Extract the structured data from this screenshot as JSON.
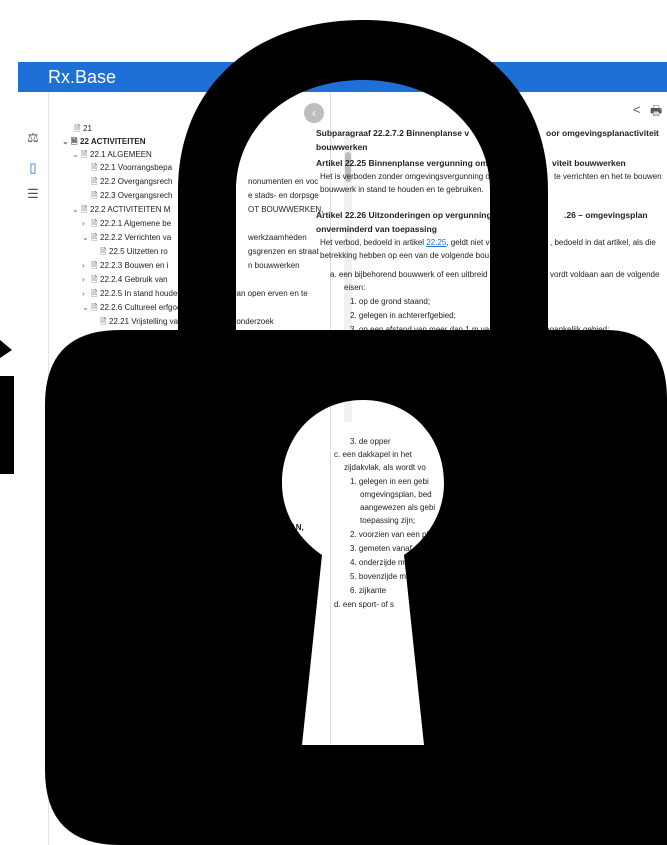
{
  "app": {
    "title": "Rx.Base"
  },
  "rail": {
    "icons": [
      "gavel-icon",
      "book-icon",
      "list-icon"
    ]
  },
  "tree": {
    "nodes": [
      {
        "label": "21",
        "icon": "doc",
        "toggle": ""
      },
      {
        "label": "22 ACTIVITEITEN",
        "icon": "doc",
        "toggle": "v",
        "bold": true
      },
      {
        "label": "22.1 ALGEMEEN",
        "icon": "doc",
        "toggle": "v"
      },
      {
        "label": "22.1 Voorrangsbepa",
        "icon": "doc",
        "toggle": ""
      },
      {
        "label": "22.2 Overgangsrech",
        "icon": "doc",
        "toggle": ""
      },
      {
        "label": "22.3 Overgangsrech",
        "icon": "doc",
        "toggle": ""
      },
      {
        "label": "22.2 ACTIVITEITEN M",
        "icon": "doc",
        "toggle": "v"
      },
      {
        "label": "22.2.1 Algemene be",
        "icon": "doc",
        "toggle": ">"
      },
      {
        "label": "22.2.2 Verrichten va",
        "icon": "doc",
        "toggle": "v"
      },
      {
        "label": "22.5 Uitzetten ro",
        "icon": "doc",
        "toggle": ""
      },
      {
        "label": "22.2.3 Bouwen en i",
        "icon": "doc",
        "toggle": ">"
      },
      {
        "label": "22.2.4 Gebruik van",
        "icon": "doc",
        "toggle": ">"
      },
      {
        "label": "22.2.5 In stand houden en gebruiken van open erven en te",
        "icon": "doc",
        "toggle": ">"
      },
      {
        "label": "22.2.6 Cultureel erfgoed",
        "icon": "doc",
        "toggle": "v"
      },
      {
        "label": "22.21 Vrijstelling van archeologisch onderzoek",
        "icon": "doc",
        "toggle": ""
      }
    ],
    "fragments": {
      "f1": "nonumenten en voc",
      "f2": "e stads- en dorpsge",
      "f3": "OT BOUWWERKEN,",
      "f4": "werkzaamheden",
      "f5": "gsgrenzen en straat",
      "f6": "n bouwwerken",
      "f7": "AN,"
    }
  },
  "content": {
    "subparagraph": "Subparagraaf 22.2.7.2 Binnenplanse v",
    "subparagraph_end": "oor omgevingsplanactiviteit",
    "subparagraph_line2": "bouwwerken",
    "art1_title": "Artikel 22.25 Binnenplanse vergunning om",
    "art1_title_end": "viteit bouwwerken",
    "art1_text1": "Het is verboden zonder omgevingsvergunning o",
    "art1_text1_end": "te verrichten en het te bouwen",
    "art1_text2": "bouwwerk in stand te houden en te gebruiken.",
    "art2_title": "Artikel 22.26 Uitzonderingen op vergunning",
    "art2_title_end": ".26 – omgevingsplan",
    "art2_title2": "onverminderd van toepassing",
    "art2_text1": "Het verbod, bedoeld in artikel",
    "art2_link": "22.25",
    "art2_text1b": ", geldt niet v",
    "art2_text1_end": ", bedoeld in dat artikel, als die",
    "art2_text2": "betrekking hebben op een van de volgende bou",
    "item_a": "a. een bijbehorend bouwwerk of een uitbreid",
    "item_a_end": "vordt voldaan aan de volgende",
    "item_a_2": "eisen:",
    "a1": "1. op de grond staand;",
    "a2": "2. gelegen in achtererfgebied;",
    "a3": "3. op een afstand van meer dan 1 m vanaf openbaar toegankelijk gebied;",
    "b3": "3. de opper",
    "item_c": "c. een dakkapel in het",
    "item_c2": "zijdakvlak, als wordt vo",
    "c1": "1. gelegen in een gebi",
    "c1b": "omgevingsplan, bed",
    "c1c": "aangewezen als gebi",
    "c1d": "toepassing zijn;",
    "c2": "2. voorzien van een pla",
    "c3": "3. gemeten vanaf de",
    "c4": "4. onderzijde meer",
    "c5": "5. bovenzijde m",
    "c6": "6. zijkante",
    "item_d": "d. een sport- of s"
  },
  "overlay": {
    "type": "padlock",
    "color": "#000000"
  }
}
